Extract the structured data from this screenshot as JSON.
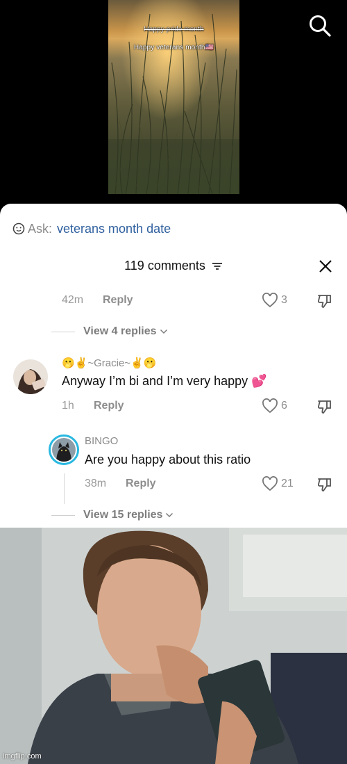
{
  "video": {
    "overlay_line1": "Happy pride month",
    "overlay_line2": "Happy veterans month🇺🇸"
  },
  "search": {
    "icon": "search-icon"
  },
  "ask": {
    "label": "Ask:",
    "query": "veterans month date"
  },
  "comments_header": {
    "title": "119 comments",
    "close_icon": "close-icon"
  },
  "top_comment_meta": {
    "time": "42m",
    "reply_label": "Reply",
    "likes": "3"
  },
  "view_replies_1": {
    "label": "View 4 replies"
  },
  "comment_gracie": {
    "username": "🫢✌️~Gracie~✌️🫢",
    "text": "Anyway I’m bi and I’m very happy 💕",
    "time": "1h",
    "reply_label": "Reply",
    "likes": "6"
  },
  "comment_bingo": {
    "username": "BINGO",
    "text": "Are you happy about this ratio",
    "time": "38m",
    "reply_label": "Reply",
    "likes": "21"
  },
  "view_replies_2": {
    "label": "View 15 replies"
  },
  "watermark": "imgflip.com",
  "colors": {
    "link_blue": "#2e5f9e",
    "muted_gray": "#8d8d8d",
    "story_ring": "#29b8e0"
  }
}
